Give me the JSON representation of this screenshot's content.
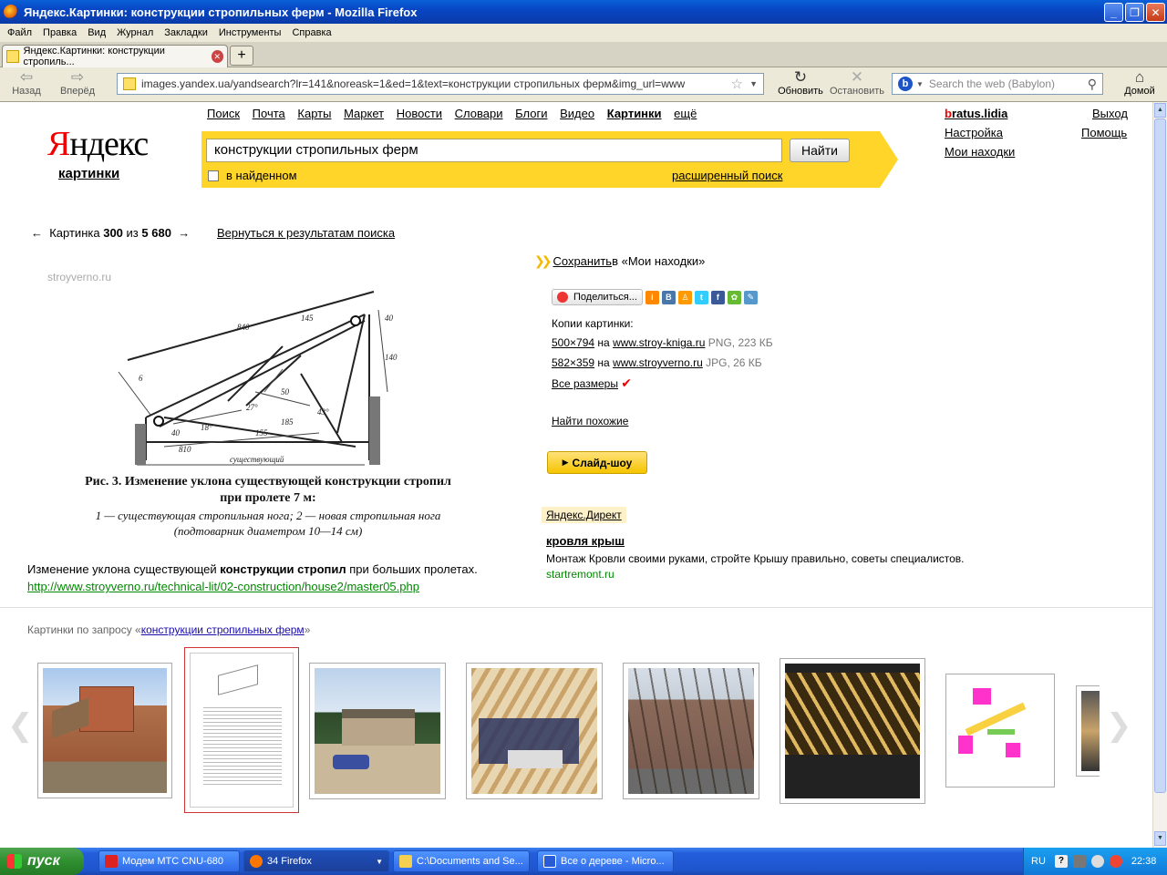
{
  "window": {
    "title": "Яндекс.Картинки: конструкции стропильных ферм - Mozilla Firefox"
  },
  "menu": [
    "Файл",
    "Правка",
    "Вид",
    "Журнал",
    "Закладки",
    "Инструменты",
    "Справка"
  ],
  "tab": {
    "label": "Яндекс.Картинки: конструкции стропиль..."
  },
  "nav": {
    "back": "Назад",
    "forward": "Вперёд",
    "reload": "Обновить",
    "stop": "Остановить",
    "home": "Домой"
  },
  "url": "images.yandex.ua/yandsearch?lr=141&noreask=1&ed=1&text=конструкции стропильных ферм&img_url=www",
  "websearch": {
    "placeholder": "Search the web (Babylon)"
  },
  "header": {
    "logo_first": "Я",
    "logo_rest": "ндекс",
    "logo_sub": "картинки",
    "services": [
      "Поиск",
      "Почта",
      "Карты",
      "Маркет",
      "Новости",
      "Словари",
      "Блоги",
      "Видео",
      "Картинки",
      "ещё"
    ],
    "query": "конструкции стропильных ферм",
    "find_label": "Найти",
    "in_found": "в найденном",
    "advanced": "расширенный поиск",
    "user_first": "b",
    "user_rest": "ratus.lidia",
    "settings": "Настройка",
    "my_finds": "Мои находки",
    "logout": "Выход",
    "help": "Помощь"
  },
  "viewer": {
    "prev_arrow": "←",
    "next_arrow": "→",
    "pos_label": "Картинка",
    "pos": "300",
    "of": "из",
    "total": "5 680",
    "back_to_results": "Вернуться к результатам поиска",
    "watermark": "stroyverno.ru",
    "fig_caption_1": "Рис. 3. Изменение уклона существующей конструкции стропил",
    "fig_caption_2": "при пролете 7 м:",
    "fig_caption_3": "1 — существующая стропильная нога; 2 — новая стропильная нога",
    "fig_caption_4": "(подтоварник диаметром 10—14 см)",
    "dim_labels": [
      "840",
      "145",
      "40",
      "140",
      "6",
      "27°",
      "50",
      "43°",
      "18°",
      "155",
      "185",
      "40",
      "810",
      "существующий"
    ],
    "caption_pre": "Изменение уклона существующей ",
    "caption_bold": "конструкции стропил",
    "caption_post": " при больших пролетах.",
    "source_url": "http://www.stroyverno.ru/technical-lit/02-construction/house2/master05.php"
  },
  "side": {
    "save_link": "Сохранить",
    "save_rest": " в «Мои находки»",
    "share": "Поделиться...",
    "copies_label": "Копии картинки:",
    "copies": [
      {
        "size": "500×794",
        "on": "на",
        "site": "www.stroy-kniga.ru",
        "meta": "PNG, 223 КБ"
      },
      {
        "size": "582×359",
        "on": "на",
        "site": "www.stroyverno.ru",
        "meta": "JPG, 26 КБ"
      }
    ],
    "all_sizes": "Все размеры",
    "similar": "Найти похожие",
    "slideshow": "Слайд-шоу",
    "direct_label": "Яндекс.Директ",
    "ad_title": "кровля крыш",
    "ad_text": "Монтаж Кровли своими руками, стройте Крышу правильно, советы специалистов.",
    "ad_domain": "startremont.ru"
  },
  "related": {
    "prefix": "Картинки по запросу «",
    "query": "конструкции стропильных ферм",
    "suffix": "»"
  },
  "taskbar": {
    "start": "пуск",
    "tasks": [
      "Модем МТС CNU-680",
      "34 Firefox",
      "C:\\Documents and Se...",
      "Все о дереве - Micro..."
    ],
    "lang": "RU",
    "clock": "22:38"
  },
  "colors": {
    "yandex_red": "#e00000",
    "yandex_yellow": "#ffd52a",
    "link": "#1a0dab",
    "url_green": "#008000"
  }
}
